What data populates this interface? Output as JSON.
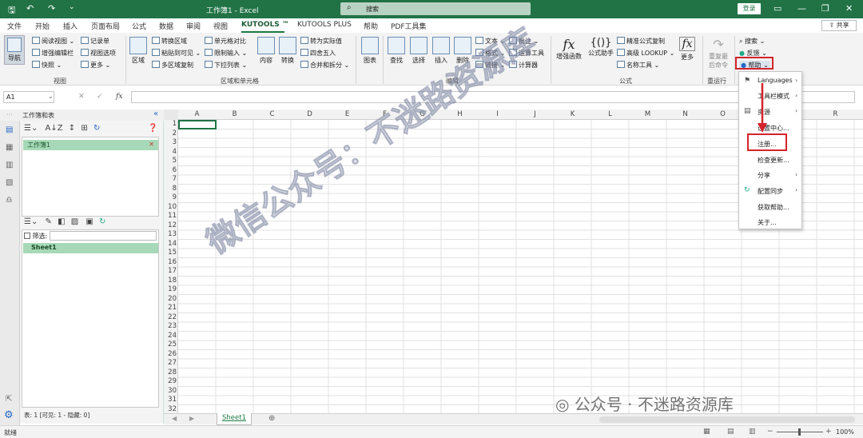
{
  "app": {
    "title": "工作簿1 - Excel",
    "search_placeholder": "搜索",
    "login": "登录",
    "share": "共享"
  },
  "menu": [
    "文件",
    "开始",
    "插入",
    "页面布局",
    "公式",
    "数据",
    "审阅",
    "视图",
    "KUTOOLS ™",
    "KUTOOLS PLUS",
    "帮助",
    "PDF工具集"
  ],
  "ribbon": {
    "nav": "导航",
    "view_group": {
      "items": [
        "阅读视图",
        "记录单",
        "增强编辑栏",
        "视图选项",
        "快照",
        "更多"
      ],
      "label": "视图"
    },
    "region_group": {
      "big": "区域",
      "items": [
        "转换区域",
        "单元格对比",
        "转为实际值",
        "粘贴到可见",
        "限制输入",
        "四舍五入",
        "多区域复制",
        "下拉列表",
        "合并和拆分"
      ],
      "big2": "内容",
      "big3": "转换",
      "label": "区域和单元格"
    },
    "edit_group": {
      "big": [
        "图表",
        "查找",
        "选择",
        "插入",
        "删除"
      ],
      "items": [
        "文本",
        "批注",
        "格式",
        "运算工具",
        "链接",
        "计算器"
      ],
      "label": "编辑"
    },
    "formula_group": {
      "big": [
        "增强函数",
        "公式助手"
      ],
      "items": [
        "精准公式复制",
        "高级 LOOKUP",
        "名称工具"
      ],
      "more": "更多",
      "label": "公式"
    },
    "rerun": {
      "label1": "重复最",
      "label2": "后命令",
      "group": "重运行"
    },
    "help_group": {
      "search": "搜索",
      "feedback": "反馈",
      "help": "帮助"
    }
  },
  "formula_bar": {
    "cell_ref": "A1",
    "fx": "fx"
  },
  "nav_pane": {
    "title": "工作簿和表",
    "workbook": "工作簿1",
    "filter_label": "筛选:",
    "sheet": "Sheet1",
    "footer": "表: 1 [可见: 1 - 隐藏: 0]"
  },
  "grid": {
    "columns": [
      "A",
      "B",
      "C",
      "D",
      "E",
      "F",
      "G",
      "H",
      "I",
      "J",
      "K",
      "L",
      "M",
      "N",
      "O",
      "P",
      "Q",
      "R"
    ],
    "rows": [
      "1",
      "2",
      "3",
      "4",
      "5",
      "6",
      "7",
      "8",
      "9",
      "10",
      "11",
      "12",
      "13",
      "14",
      "15",
      "16",
      "17",
      "18",
      "19",
      "20",
      "21",
      "22",
      "23",
      "24",
      "25",
      "26",
      "27",
      "28",
      "29",
      "30",
      "31",
      "32"
    ]
  },
  "sheet_tab": "Sheet1",
  "status": {
    "ready": "就绪",
    "zoom": "100%"
  },
  "help_menu": [
    "Languages",
    "工具栏模式",
    "资源",
    "设置中心...",
    "注册...",
    "检查更新...",
    "分享",
    "配置同步",
    "获取帮助...",
    "关于..."
  ],
  "watermark": {
    "main": "微信公众号：不迷路资源库",
    "corner": "公众号 · 不迷路资源库"
  },
  "colors": {
    "excel_green": "#217346",
    "highlight_red": "#d4232b"
  }
}
